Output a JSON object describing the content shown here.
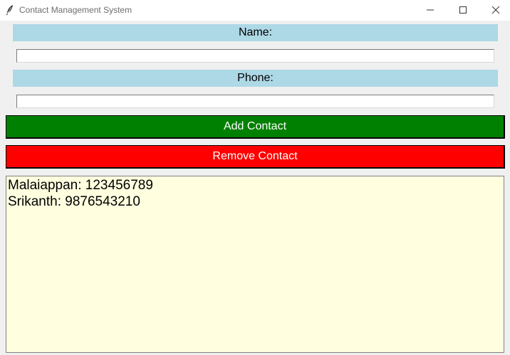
{
  "window": {
    "title": "Contact Management System",
    "icon": "feather-icon"
  },
  "form": {
    "name_label": "Name:",
    "name_value": "",
    "phone_label": "Phone:",
    "phone_value": ""
  },
  "buttons": {
    "add_label": "Add Contact",
    "add_color": "#008000",
    "remove_label": "Remove Contact",
    "remove_color": "#ff0000"
  },
  "contacts": {
    "items": [
      "Malaiappan: 123456789",
      "Srikanth: 9876543210"
    ],
    "background": "#ffffe0"
  },
  "colors": {
    "label_background": "#add8e6"
  }
}
